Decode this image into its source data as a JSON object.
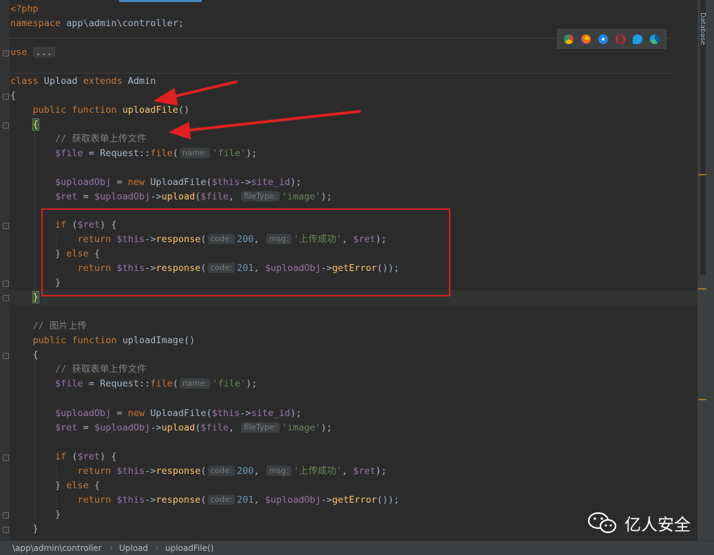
{
  "code": {
    "php_open": "<?php",
    "ns_kw": "namespace",
    "ns_value": "app\\admin\\controller;",
    "use_kw": "use",
    "use_dots": "...",
    "class_kw": "class",
    "class_name": "Upload",
    "extends_kw": "extends",
    "parent_name": "Admin",
    "open_brace": "{",
    "close_brace": "}",
    "public_kw": "public",
    "function_kw": "function",
    "fn1_name": "uploadFile",
    "fn2_name": "uploadImage",
    "parens": "()",
    "comment_form": "// 获取表单上传文件",
    "comment_image": "// 图片上传",
    "file_var": "$file",
    "eq": " = ",
    "request_call": "Request::",
    "file_fn": "file",
    "name_hint": "name:",
    "file_str": "'file'",
    "close_semi": ");",
    "upload_obj_var": "$uploadObj",
    "new_kw": "new",
    "upload_file_cls": "UploadFile",
    "this_var": "$this",
    "arrow": "->",
    "site_id": "site_id",
    "ret_var": "$ret",
    "upload_fn": "upload",
    "comma": ", ",
    "filetype_hint": "fileType:",
    "image_str": "'image'",
    "if_kw": "if",
    "else_kw": "else",
    "return_kw": "return",
    "response_fn": "response",
    "code_hint": "code:",
    "msg_hint": "msg:",
    "code_200": "200",
    "code_201": "201",
    "success_str": "'上传成功'",
    "get_error_fn": "getError",
    "ret_end": "());"
  },
  "browsers": [
    "chrome-icon",
    "firefox-icon",
    "safari-icon",
    "opera-icon",
    "ie-icon",
    "edge-icon"
  ],
  "side_tab": "Database",
  "breadcrumb": {
    "path": "\\app\\admin\\controller",
    "class": "Upload",
    "method": "uploadFile()"
  },
  "watermark": {
    "text": "亿人安全"
  },
  "colors": {
    "keyword": "#cc7832",
    "variable": "#9876aa",
    "function": "#ffc66d",
    "string": "#6a8759",
    "number": "#6897bb",
    "highlight_box": "#e02020"
  }
}
